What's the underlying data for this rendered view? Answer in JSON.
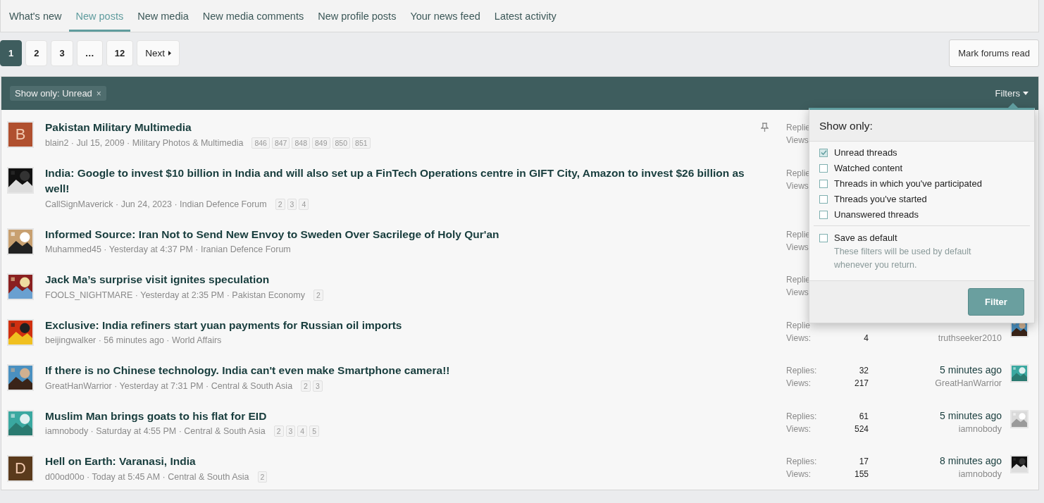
{
  "tabs": [
    {
      "label": "What's new",
      "selected": false
    },
    {
      "label": "New posts",
      "selected": true
    },
    {
      "label": "New media",
      "selected": false
    },
    {
      "label": "New media comments",
      "selected": false
    },
    {
      "label": "New profile posts",
      "selected": false
    },
    {
      "label": "Your news feed",
      "selected": false
    },
    {
      "label": "Latest activity",
      "selected": false
    }
  ],
  "pagination": {
    "pages": [
      {
        "label": "1",
        "selected": true
      },
      {
        "label": "2",
        "selected": false
      },
      {
        "label": "3",
        "selected": false
      },
      {
        "label": "…",
        "selected": false
      },
      {
        "label": "12",
        "selected": false
      }
    ],
    "next": "Next"
  },
  "mark_read": "Mark forums read",
  "filter_bar": {
    "active_filter": "Show only: Unread",
    "remove": "×",
    "filters_button": "Filters"
  },
  "threads": [
    {
      "avatar": {
        "kind": "letter",
        "letter": "B",
        "color": "#b0502f"
      },
      "title": "Pakistan Military Multimedia",
      "meta": "blain2 · Jul 15, 2009 · Military Photos & Multimedia",
      "pages": [
        "846",
        "847",
        "848",
        "849",
        "850",
        "851"
      ],
      "pinned": true,
      "replies_label": "Replie",
      "views_label": "Views"
    },
    {
      "avatar": {
        "kind": "picture"
      },
      "title": "India: Google to invest $10 billion in India and will also set up a FinTech Operations centre in GIFT City, Amazon to invest $26 billion as well!",
      "meta": "CallSignMaverick · Jun 24, 2023 · Indian Defence Forum",
      "pages": [
        "2",
        "3",
        "4"
      ],
      "pinned": false,
      "replies_label": "Replie",
      "views_label": "Views"
    },
    {
      "avatar": {
        "kind": "picture"
      },
      "title": "Informed Source: Iran Not to Send New Envoy to Sweden Over Sacrilege of Holy Qur'an",
      "meta": "Muhammed45 · Yesterday at 4:37 PM · Iranian Defence Forum",
      "pinned": false,
      "replies_label": "Replie",
      "views_label": "Views"
    },
    {
      "avatar": {
        "kind": "picture"
      },
      "title": "Jack Ma’s surprise visit ignites speculation",
      "meta": "FOOLS_NIGHTMARE · Yesterday at 2:35 PM · Pakistan Economy",
      "pages": [
        "2"
      ],
      "pinned": false,
      "replies_label": "Replie",
      "views_label": "Views"
    },
    {
      "avatar": {
        "kind": "picture"
      },
      "title": "Exclusive: India refiners start yuan payments for Russian oil imports",
      "meta": "beijingwalker · 56 minutes ago · World Affairs",
      "pinned": false,
      "replies_label": "Replie",
      "views_label": "Views:",
      "views": "4",
      "last_user": "truthseeker2010",
      "last_avatar": {
        "kind": "picture"
      }
    },
    {
      "avatar": {
        "kind": "picture"
      },
      "title": "If there is no Chinese technology. India can't even make Smartphone camera!!",
      "meta": "GreatHanWarrior · Yesterday at 7:31 PM · Central & South Asia",
      "pages": [
        "2",
        "3"
      ],
      "pinned": false,
      "replies_label": "Replies:",
      "replies": "32",
      "views_label": "Views:",
      "views": "217",
      "last_time": "5 minutes ago",
      "last_user": "GreatHanWarrior",
      "last_avatar": {
        "kind": "picture"
      }
    },
    {
      "avatar": {
        "kind": "picture"
      },
      "title": "Muslim Man brings goats to his flat for EID",
      "meta": "iamnobody · Saturday at 4:55 PM · Central & South Asia",
      "pages": [
        "2",
        "3",
        "4",
        "5"
      ],
      "pinned": false,
      "replies_label": "Replies:",
      "replies": "61",
      "views_label": "Views:",
      "views": "524",
      "last_time": "5 minutes ago",
      "last_user": "iamnobody",
      "last_avatar": {
        "kind": "picture"
      }
    },
    {
      "avatar": {
        "kind": "letter",
        "letter": "D",
        "color": "#5a3a1c"
      },
      "title": "Hell on Earth: Varanasi, India",
      "meta": "d00od00o · Today at 5:45 AM · Central & South Asia",
      "pages": [
        "2"
      ],
      "pinned": false,
      "replies_label": "Replies:",
      "replies": "17",
      "views_label": "Views:",
      "views": "155",
      "last_time": "8 minutes ago",
      "last_user": "iamnobody",
      "last_avatar": {
        "kind": "picture"
      }
    }
  ],
  "filter_menu": {
    "title": "Show only:",
    "options": [
      {
        "label": "Unread threads",
        "checked": true
      },
      {
        "label": "Watched content",
        "checked": false
      },
      {
        "label": "Threads in which you've participated",
        "checked": false
      },
      {
        "label": "Threads you've started",
        "checked": false
      },
      {
        "label": "Unanswered threads",
        "checked": false
      }
    ],
    "save_default": {
      "label": "Save as default",
      "checked": false,
      "hint": "These filters will be used by default whenever you return."
    },
    "button": "Filter"
  }
}
